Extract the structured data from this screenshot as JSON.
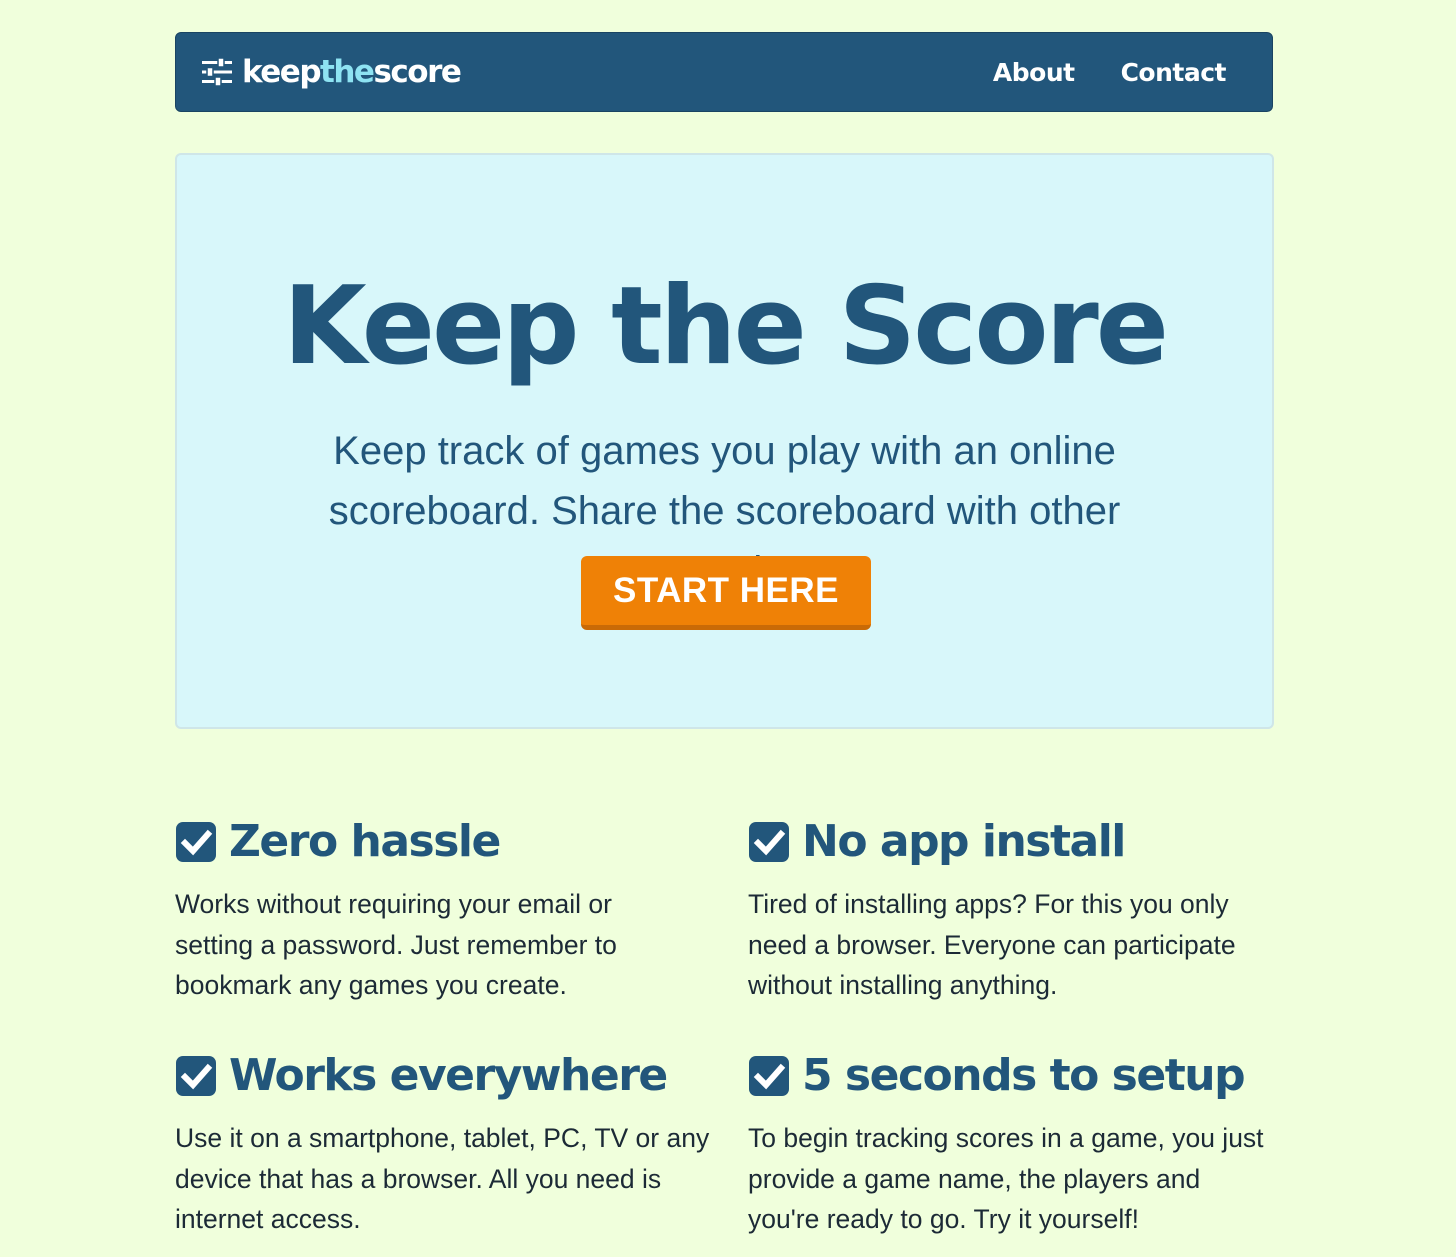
{
  "header": {
    "brand": {
      "part1": "keep",
      "part2": "the",
      "part3": "score",
      "icon": "sliders-icon"
    },
    "nav": [
      {
        "label": "About"
      },
      {
        "label": "Contact"
      }
    ]
  },
  "hero": {
    "title": "Keep the Score",
    "subtitle_line1": "Keep track of games you play with an online",
    "subtitle_line2": "scoreboard. Share the scoreboard with other people",
    "cta_label": "START HERE"
  },
  "features": [
    {
      "title": "Zero hassle",
      "icon": "checkbox-icon",
      "lines": [
        "Works without requiring your email or",
        "setting a password. Just remember to",
        "bookmark any games you create."
      ]
    },
    {
      "title": "No app install",
      "icon": "checkbox-icon",
      "lines": [
        "Tired of installing apps? For this you only",
        "need a browser. Everyone can participate",
        "without installing anything."
      ]
    },
    {
      "title": "Works everywhere",
      "icon": "checkbox-icon",
      "lines": [
        "Use it on a smartphone, tablet, PC, TV or any",
        "device that has a browser. All you need is",
        "internet access."
      ]
    },
    {
      "title": "5 seconds to setup",
      "icon": "checkbox-icon",
      "lines": [
        "To begin tracking scores in a game, you just",
        "provide a game name, the players and",
        "you're ready to go. Try it yourself!"
      ]
    }
  ],
  "colors": {
    "page_background": "#f0ffdc",
    "navbar": "#22567b",
    "brand_accent": "#8ee3f2",
    "hero_background": "#d8f7fa",
    "heading": "#22567b",
    "cta": "#ef8106"
  }
}
